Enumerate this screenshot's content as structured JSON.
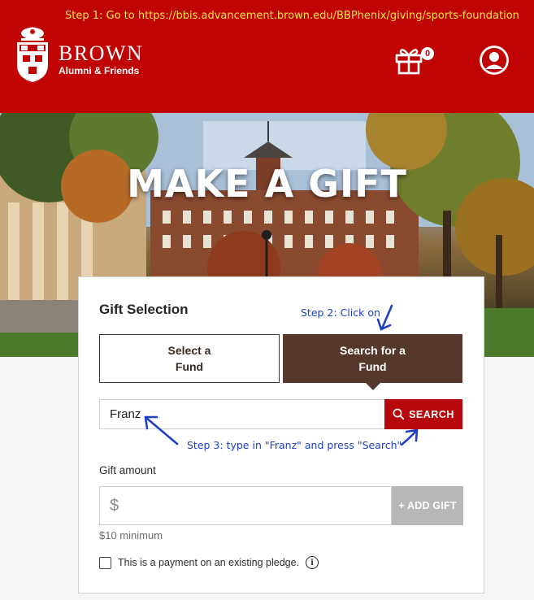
{
  "annotations": {
    "step1": "Step 1: Go to https://bbis.advancement.brown.edu/BBPhenix/giving/sports-foundation",
    "step2": "Step 2: Click on",
    "step3": "Step 3: type in \"Franz\" and press \"Search\"",
    "color": "#1f3fbf",
    "step1_color": "#f7e34a"
  },
  "header": {
    "brand": "BROWN",
    "subtitle": "Alumni & Friends",
    "cart_count": "0",
    "background": "#c00404",
    "icons": [
      "brown-shield-logo",
      "gift-cart-icon",
      "account-icon"
    ]
  },
  "hero": {
    "title": "MAKE A GIFT"
  },
  "gift_selection": {
    "title": "Gift Selection",
    "tabs": [
      {
        "label": "Select a\nFund",
        "active": false
      },
      {
        "label": "Search for a\nFund",
        "active": true
      }
    ],
    "search_value": "Franz",
    "search_button": "SEARCH",
    "amount_label": "Gift amount",
    "currency_symbol": "$",
    "add_gift_button": "+ ADD GIFT",
    "minimum_text": "$10 minimum",
    "pledge_text": "This is a payment on an existing pledge.",
    "info_glyph": "i",
    "colors": {
      "active_tab": "#55382b",
      "search_button": "#b5070c",
      "add_gift_disabled": "#b7b7b7"
    }
  }
}
